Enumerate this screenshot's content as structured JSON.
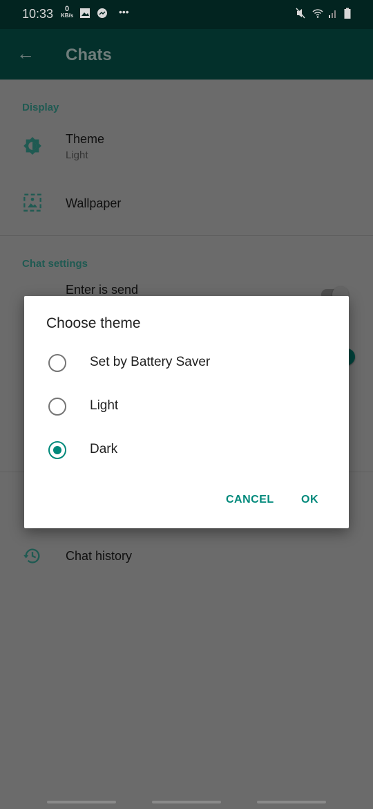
{
  "status_bar": {
    "time": "10:33",
    "net_speed_value": "0",
    "net_speed_unit": "KB/s",
    "icons": [
      "image-icon",
      "messenger-icon",
      "more-dots-icon",
      "mute-icon",
      "wifi-icon",
      "signal-icon",
      "battery-icon"
    ],
    "more": "•••"
  },
  "header": {
    "title": "Chats",
    "back_icon": "arrow-left-icon"
  },
  "sections": {
    "display": {
      "label": "Display",
      "theme_title": "Theme",
      "theme_value": "Light",
      "wallpaper_title": "Wallpaper"
    },
    "chat_settings": {
      "label": "Chat settings",
      "enter_is_send": "Enter is send",
      "enter_is_send_on": false,
      "second_toggle_on": true
    },
    "history": {
      "chat_history": "Chat history"
    }
  },
  "dialog": {
    "title": "Choose theme",
    "options": [
      {
        "label": "Set by Battery Saver",
        "selected": false
      },
      {
        "label": "Light",
        "selected": false
      },
      {
        "label": "Dark",
        "selected": true
      }
    ],
    "cancel": "CANCEL",
    "ok": "OK"
  },
  "colors": {
    "primary": "#075e54",
    "accent": "#00897b"
  }
}
